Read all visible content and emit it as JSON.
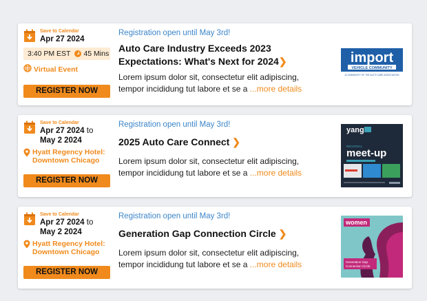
{
  "colors": {
    "accent": "#f08a1c",
    "link": "#3b85c9"
  },
  "events": [
    {
      "save_label": "Save to Calendar",
      "date_start": "Apr 27 2024",
      "time": "3:40 PM EST",
      "duration": "45 Mins",
      "venue": "Virtual Event",
      "register_label": "REGISTER NOW",
      "registration_note": "Registration open until May 3rd!",
      "title_line1": "Auto Care Industry Exceeds 2023",
      "title_line2": "Expectations: What's Next for 2024",
      "chevron": "❯",
      "desc_line1": "Lorem ipsum dolor sit, consectetur elit adipiscing,",
      "desc_line2": "tempor incididung tut labore et  se a",
      "more_label": "...more details",
      "thumb": {
        "word": "import",
        "sub": "VEHICLE COMMUNITY",
        "caption": "A COMMUNITY OF THE AUTO CARE ASSOCIATION"
      }
    },
    {
      "save_label": "Save to Calendar",
      "date_start": "Apr 27 2024",
      "to_label": "to",
      "date_end": "May 2 2024",
      "venue_line1": "Hyatt Regency Hotel:",
      "venue_line2": "Downtown Chicago",
      "register_label": "REGISTER NOW",
      "registration_note": "Registration open until May 3rd!",
      "title": "2025 Auto Care Connect",
      "chevron": "❯",
      "desc_line1": "Lorem ipsum dolor sit, consectetur elit adipiscing,",
      "desc_line2": "tempor incididung tut labore et  se a",
      "more_label": "...more details",
      "thumb": {
        "brand": "yang",
        "headline1": "meet-up",
        "kicker": "REGIONAL"
      }
    },
    {
      "save_label": "Save to Calendar",
      "date_start": "Apr 27 2024",
      "to_label": "to",
      "date_end": "May 2 2024",
      "venue_line1": "Hyatt Regency Hotel:",
      "venue_line2": "Downtown Chicago",
      "register_label": "REGISTER NOW",
      "registration_note": "Registration open until May 3rd!",
      "title": "Generation Gap Connection Circle",
      "chevron": "❯",
      "desc_line1": "Lorem ipsum dolor sit, consectetur elit adipiscing,",
      "desc_line2": "tempor incididung tut labore et  se a",
      "more_label": "...more details",
      "thumb": {
        "brand": "women",
        "caption1": "Generation Gap",
        "caption2": "Connection Circle"
      }
    }
  ]
}
